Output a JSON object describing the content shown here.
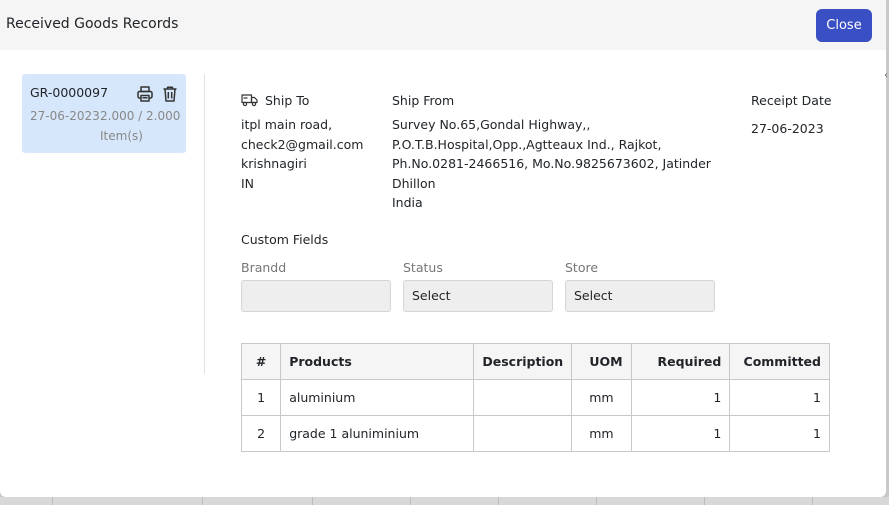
{
  "modal": {
    "title": "Received Goods Records",
    "close_label": "Close"
  },
  "records": [
    {
      "number": "GR-0000097",
      "date": "27-06-2023",
      "quantity": "2.000 / 2.000",
      "items_label": "Item(s)"
    }
  ],
  "ship_to": {
    "label": "Ship To",
    "lines": [
      "itpl main road,",
      "check2@gmail.com",
      "krishnagiri",
      "IN"
    ]
  },
  "ship_from": {
    "label": "Ship From",
    "lines": [
      "Survey No.65,Gondal Highway,,",
      "P.O.T.B.Hospital,Opp.,Agtteaux Ind., Rajkot,",
      "Ph.No.0281-2466516, Mo.No.9825673602, Jatinder",
      "Dhillon",
      "India"
    ]
  },
  "receipt": {
    "label": "Receipt Date",
    "value": "27-06-2023"
  },
  "custom_fields": {
    "title": "Custom Fields",
    "fields": [
      {
        "label": "Brandd",
        "value": ""
      },
      {
        "label": "Status",
        "value": "Select"
      },
      {
        "label": "Store",
        "value": "Select"
      }
    ]
  },
  "table": {
    "headers": [
      "#",
      "Products",
      "Description",
      "UOM",
      "Required",
      "Committed"
    ],
    "rows": [
      {
        "num": "1",
        "product": "aluminium",
        "description": "",
        "uom": "mm",
        "required": "1",
        "committed": "1"
      },
      {
        "num": "2",
        "product": "grade 1 aluniminium",
        "description": "",
        "uom": "mm",
        "required": "1",
        "committed": "1"
      }
    ]
  },
  "icons": {
    "print": "print-icon",
    "delete": "trash-icon",
    "truck": "truck-icon"
  },
  "colors": {
    "primary": "#3a4fc4",
    "selected_card": "#d7e7fb",
    "header_bg": "#f5f5f5"
  }
}
